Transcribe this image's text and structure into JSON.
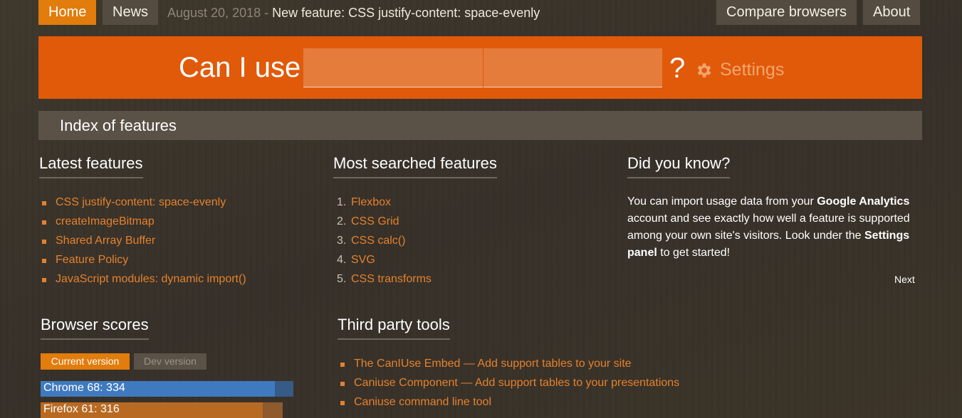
{
  "nav": {
    "home": "Home",
    "news": "News",
    "compare": "Compare browsers",
    "about": "About"
  },
  "news": {
    "date": "August 20, 2018",
    "separator": " - ",
    "headline": "New feature: CSS justify-content: space-evenly"
  },
  "search": {
    "prefix": "Can I use",
    "suffix": "?",
    "settings_label": "Settings",
    "settings_icon": "gear-icon"
  },
  "index_bar": "Index of features",
  "latest": {
    "title": "Latest features",
    "items": [
      "CSS justify-content: space-evenly",
      "createImageBitmap",
      "Shared Array Buffer",
      "Feature Policy",
      "JavaScript modules: dynamic import()"
    ]
  },
  "most_searched": {
    "title": "Most searched features",
    "items": [
      {
        "num": "1.",
        "label": "Flexbox"
      },
      {
        "num": "2.",
        "label": "CSS Grid"
      },
      {
        "num": "3.",
        "label": "CSS calc()"
      },
      {
        "num": "4.",
        "label": "SVG"
      },
      {
        "num": "5.",
        "label": "CSS transforms"
      }
    ]
  },
  "did_you_know": {
    "title": "Did you know?",
    "t1": "You can import usage data from your ",
    "b1": "Google Analytics",
    "t2": " account and see exactly how well a feature is supported among your own site's visitors. Look under the ",
    "b2": "Settings panel",
    "t3": " to get started!",
    "next": "Next"
  },
  "browser_scores": {
    "title": "Browser scores",
    "current_label": "Current version",
    "dev_label": "Dev version",
    "bars": [
      {
        "label": "Chrome 68: 334",
        "score": 334,
        "dev_score": 348,
        "color": "#3f7ac0",
        "dev_color": "#365b86"
      },
      {
        "label": "Firefox 61: 316",
        "score": 316,
        "dev_score": 333,
        "color": "#b86a23",
        "dev_color": "#8e5a2e"
      }
    ]
  },
  "third_party": {
    "title": "Third party tools",
    "items": [
      "The CanIUse Embed — Add support tables to your site",
      "Caniuse Component — Add support tables to your presentations",
      "Caniuse command line tool"
    ]
  },
  "colors": {
    "accent": "#e27c0c",
    "banner": "#e05a0a",
    "link": "#e5812d"
  }
}
